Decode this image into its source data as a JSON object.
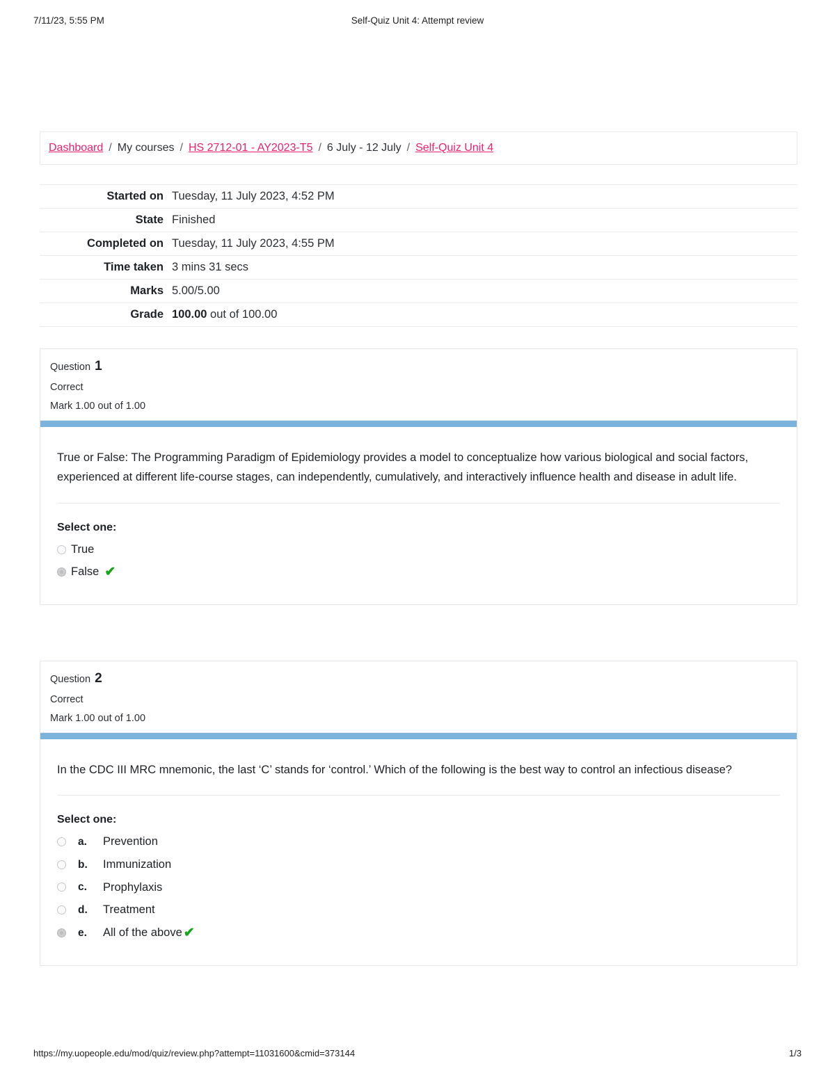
{
  "print_header": {
    "left": "7/11/23, 5:55 PM",
    "center": "Self-Quiz Unit 4: Attempt review"
  },
  "print_footer": {
    "url": "https://my.uopeople.edu/mod/quiz/review.php?attempt=11031600&cmid=373144",
    "page": "1/3"
  },
  "breadcrumb": {
    "separator": "/",
    "items": [
      {
        "label": "Dashboard",
        "link": true
      },
      {
        "label": "My courses",
        "link": false
      },
      {
        "label": "HS 2712-01 - AY2023-T5",
        "link": true
      },
      {
        "label": "6 July - 12 July",
        "link": false
      },
      {
        "label": "Self-Quiz Unit 4",
        "link": true
      }
    ]
  },
  "summary": {
    "rows": [
      {
        "label": "Started on",
        "value": "Tuesday, 11 July 2023, 4:52 PM",
        "bold_prefix": ""
      },
      {
        "label": "State",
        "value": "Finished",
        "bold_prefix": ""
      },
      {
        "label": "Completed on",
        "value": "Tuesday, 11 July 2023, 4:55 PM",
        "bold_prefix": ""
      },
      {
        "label": "Time taken",
        "value": "3 mins 31 secs",
        "bold_prefix": ""
      },
      {
        "label": "Marks",
        "value": "5.00/5.00",
        "bold_prefix": ""
      },
      {
        "label": "Grade",
        "value": " out of 100.00",
        "bold_prefix": "100.00"
      }
    ]
  },
  "colors": {
    "accent_link": "#ed1f6f",
    "question_bar": "#7cb3dd",
    "correct_tick": "#19a319",
    "card_border": "#e3e6ea"
  },
  "questions": [
    {
      "number_label": "Question",
      "number": "1",
      "state": "Correct",
      "mark": "Mark 1.00 out of 1.00",
      "text": "True or False: The Programming Paradigm of Epidemiology provides a model to conceptualize how various biological and social factors, experienced at different life-course stages, can independently, cumulatively, and interactively influence health and disease in adult life.",
      "select_label": "Select one:",
      "options": [
        {
          "letter": "",
          "text": "True",
          "selected": false,
          "correct_tick": false
        },
        {
          "letter": "",
          "text": "False",
          "selected": true,
          "correct_tick": true
        }
      ]
    },
    {
      "number_label": "Question",
      "number": "2",
      "state": "Correct",
      "mark": "Mark 1.00 out of 1.00",
      "text": "In the CDC III MRC mnemonic, the last ‘C’ stands for ‘control.’ Which of the following is the best way to control an infectious disease?",
      "select_label": "Select one:",
      "options": [
        {
          "letter": "a.",
          "text": "Prevention",
          "selected": false,
          "correct_tick": false
        },
        {
          "letter": "b.",
          "text": "Immunization",
          "selected": false,
          "correct_tick": false
        },
        {
          "letter": "c.",
          "text": "Prophylaxis",
          "selected": false,
          "correct_tick": false
        },
        {
          "letter": "d.",
          "text": "Treatment",
          "selected": false,
          "correct_tick": false
        },
        {
          "letter": "e.",
          "text": "All of the above",
          "selected": true,
          "correct_tick": true
        }
      ]
    }
  ],
  "icons": {
    "check": "✔"
  }
}
